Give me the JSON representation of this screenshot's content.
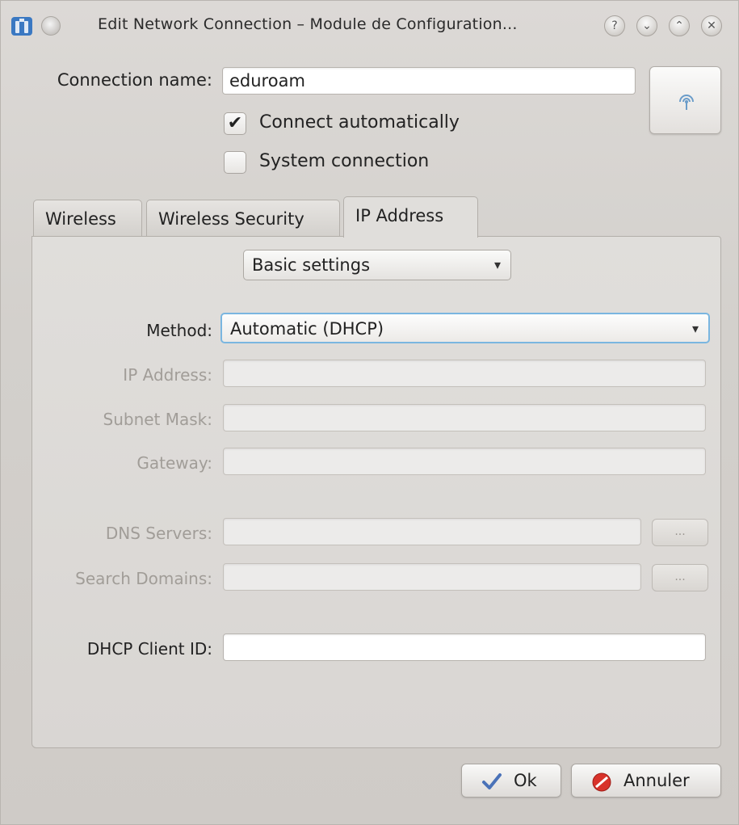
{
  "window": {
    "title": "Edit Network Connection – Module de Configuration...",
    "controls": [
      "?",
      "⌄",
      "⌃",
      "✕"
    ]
  },
  "form": {
    "connection_name_label": "Connection name:",
    "connection_name_value": "eduroam",
    "connect_automatically_label": "Connect automatically",
    "connect_automatically_checked": true,
    "system_connection_label": "System connection",
    "system_connection_checked": false
  },
  "tabs": [
    {
      "label": "Wireless",
      "active": false
    },
    {
      "label": "Wireless Security",
      "active": false
    },
    {
      "label": "IP Address",
      "active": true
    }
  ],
  "ip": {
    "settings_mode": "Basic settings",
    "method_label": "Method:",
    "method_value": "Automatic (DHCP)",
    "ip_address_label": "IP Address:",
    "subnet_mask_label": "Subnet Mask:",
    "gateway_label": "Gateway:",
    "dns_servers_label": "DNS Servers:",
    "search_domains_label": "Search Domains:",
    "dots_label": "...",
    "dhcp_client_id_label": "DHCP Client ID:",
    "dhcp_client_id_value": ""
  },
  "buttons": {
    "ok": "Ok",
    "cancel": "Annuler"
  },
  "icons": {
    "app": "network-manager-icon",
    "wifi": "wireless-antenna-icon",
    "ok": "checkmark-icon",
    "cancel": "cancel-icon"
  }
}
